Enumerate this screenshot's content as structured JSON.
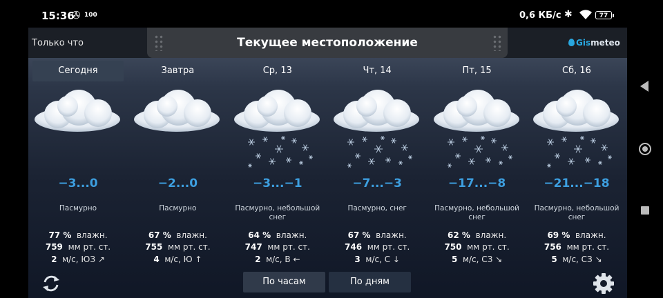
{
  "status_bar": {
    "time": "15:36",
    "fan_symbol": "✇",
    "hundred_badge": "100",
    "speed": "0,6 КБ/с",
    "bluetooth_symbol": "✱",
    "battery": "77"
  },
  "header": {
    "left_label": "Только что",
    "title": "Текущее местоположение",
    "logo_gis": "Gis",
    "logo_meteo": "meteo"
  },
  "days": [
    {
      "label": "Сегодня",
      "temp": "−3...0",
      "condition": "Пасмурно",
      "humidity": "77 %",
      "humidity_label": "влажн.",
      "pressure": "759",
      "pressure_label": "мм рт. ст.",
      "wind": "2",
      "wind_label": "м/с, ЮЗ ↗",
      "snow": false,
      "active": true
    },
    {
      "label": "Завтра",
      "temp": "−2...0",
      "condition": "Пасмурно",
      "humidity": "67 %",
      "humidity_label": "влажн.",
      "pressure": "755",
      "pressure_label": "мм рт. ст.",
      "wind": "4",
      "wind_label": "м/с, Ю ↑",
      "snow": false,
      "active": false
    },
    {
      "label": "Ср, 13",
      "temp": "−3...−1",
      "condition": "Пасмурно, небольшой снег",
      "humidity": "64 %",
      "humidity_label": "влажн.",
      "pressure": "747",
      "pressure_label": "мм рт. ст.",
      "wind": "2",
      "wind_label": "м/с, В ←",
      "snow": true,
      "active": false
    },
    {
      "label": "Чт, 14",
      "temp": "−7...−3",
      "condition": "Пасмурно, снег",
      "humidity": "67 %",
      "humidity_label": "влажн.",
      "pressure": "746",
      "pressure_label": "мм рт. ст.",
      "wind": "3",
      "wind_label": "м/с, С ↓",
      "snow": true,
      "active": false
    },
    {
      "label": "Пт, 15",
      "temp": "−17...−8",
      "condition": "Пасмурно, небольшой снег",
      "humidity": "62 %",
      "humidity_label": "влажн.",
      "pressure": "750",
      "pressure_label": "мм рт. ст.",
      "wind": "5",
      "wind_label": "м/с, СЗ ↘",
      "snow": true,
      "active": false
    },
    {
      "label": "Сб, 16",
      "temp": "−21...−18",
      "condition": "Пасмурно, небольшой снег",
      "humidity": "69 %",
      "humidity_label": "влажн.",
      "pressure": "756",
      "pressure_label": "мм рт. ст.",
      "wind": "5",
      "wind_label": "м/с, СЗ ↘",
      "snow": true,
      "active": false
    }
  ],
  "footer": {
    "hourly_button": "По часам",
    "daily_button": "По дням"
  },
  "colors": {
    "temp_blue": "#3d9fe0",
    "logo_blue": "#29a7df"
  }
}
